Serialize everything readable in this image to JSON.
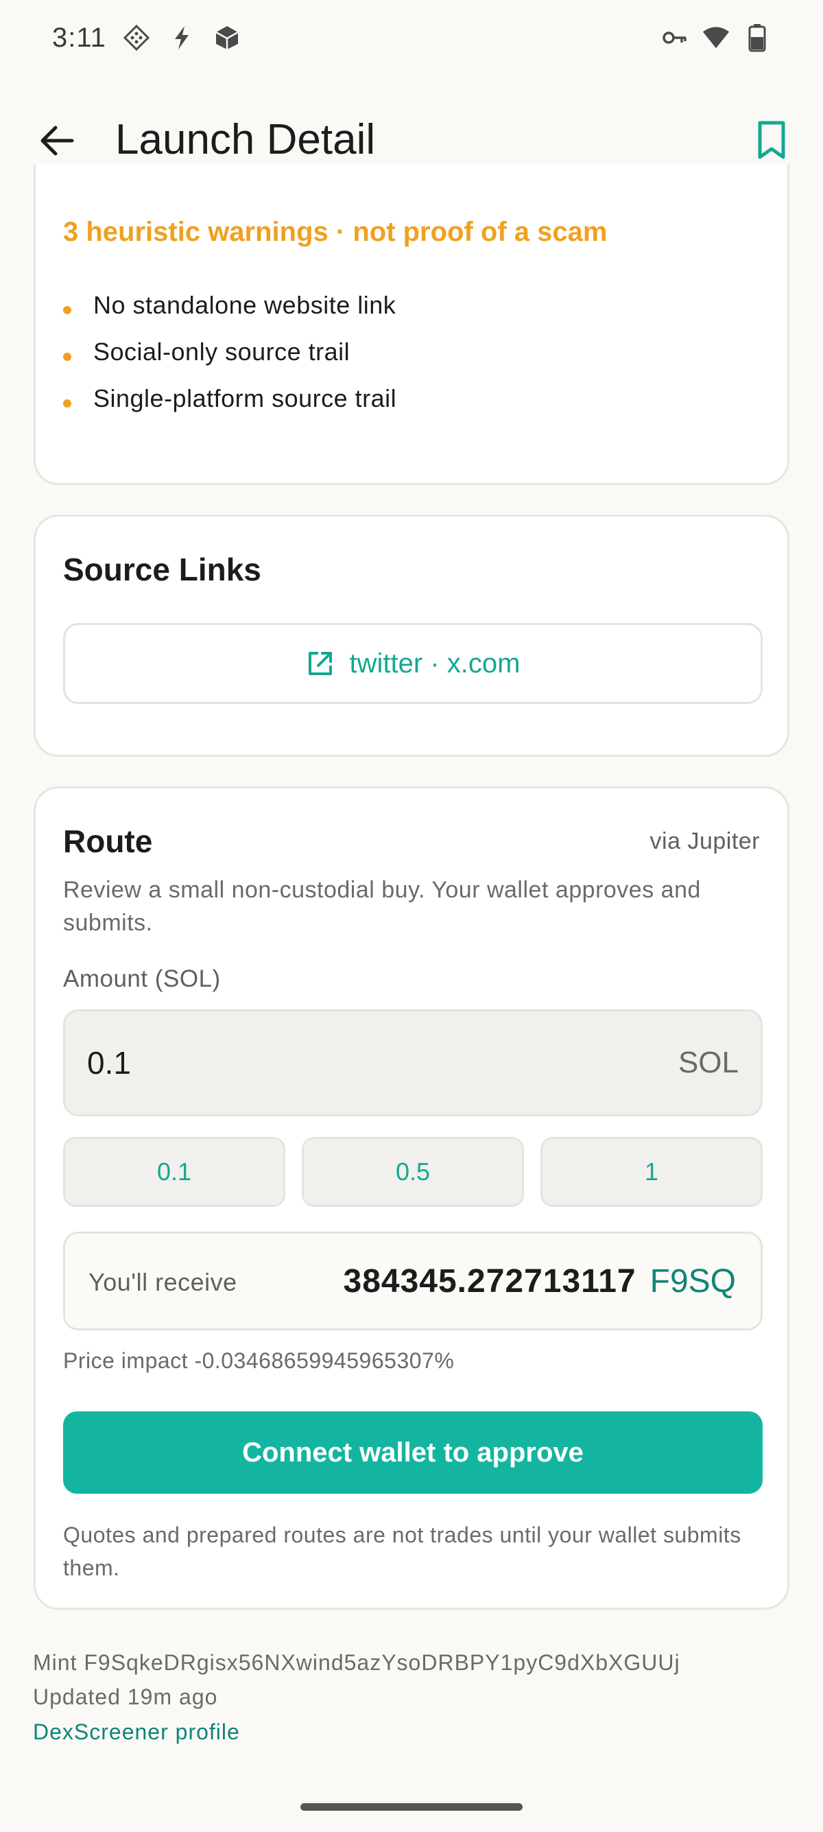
{
  "status_bar": {
    "time": "3:11"
  },
  "app_bar": {
    "title": "Launch Detail"
  },
  "warnings": {
    "title": "3 heuristic warnings · not proof of a scam",
    "items": [
      "No standalone website link",
      "Social-only source trail",
      "Single-platform source trail"
    ],
    "accent_color": "#f0a020"
  },
  "source_links": {
    "heading": "Source Links",
    "link_label": "twitter · x.com"
  },
  "route": {
    "heading": "Route",
    "via": "via Jupiter",
    "description": "Review a small non-custodial buy. Your wallet approves and submits.",
    "amount_label": "Amount (SOL)",
    "amount_value": "0.1",
    "amount_unit": "SOL",
    "quick_amounts": [
      "0.1",
      "0.5",
      "1"
    ],
    "receive_label": "You'll receive",
    "receive_amount": "384345.272713117",
    "receive_token": "F9SQ",
    "price_impact": "Price impact -0.03468659945965307%",
    "connect_button": "Connect wallet to approve",
    "note": "Quotes and prepared routes are not trades until your wallet submits them.",
    "accent_color": "#13b5a0"
  },
  "footer": {
    "mint": "Mint F9SqkeDRgisx56NXwind5azYsoDRBPY1pyC9dXbXGUUj",
    "updated": "Updated 19m ago",
    "profile_link": "DexScreener profile"
  }
}
